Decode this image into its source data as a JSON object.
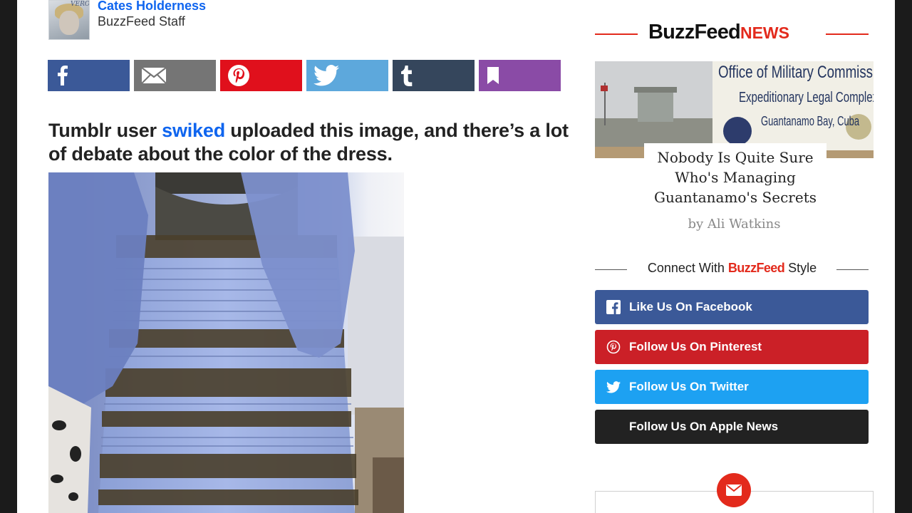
{
  "author": {
    "name": "Cates Holderness",
    "role": "BuzzFeed Staff",
    "avatar_text": "VERO"
  },
  "share_buttons": [
    {
      "name": "share-facebook-button",
      "icon": "facebook-icon",
      "color": "#3b5998"
    },
    {
      "name": "share-email-button",
      "icon": "email-icon",
      "color": "#757575"
    },
    {
      "name": "share-pinterest-button",
      "icon": "pinterest-icon",
      "color": "#e0101c"
    },
    {
      "name": "share-twitter-button",
      "icon": "twitter-icon",
      "color": "#5da8dc"
    },
    {
      "name": "share-tumblr-button",
      "icon": "tumblr-icon",
      "color": "#35465c"
    },
    {
      "name": "share-bookmark-button",
      "icon": "bookmark-icon",
      "color": "#8a4ba6"
    }
  ],
  "article": {
    "lead_before": "Tumblr user ",
    "lead_link": "swiked",
    "lead_after": " uploaded this image, and there’s a lot of debate about the color of the dress."
  },
  "sidebar": {
    "brand_primary": "BuzzFeed",
    "brand_secondary": "NEWS",
    "promo": {
      "sign_line1": "Office of Military Commissio",
      "sign_line2": "Expeditionary Legal Complex",
      "sign_line3": "Guantanamo Bay, Cuba",
      "title": "Nobody Is Quite Sure Who's Managing Guantanamo's Secrets",
      "byline": "by Ali Watkins"
    },
    "connect": {
      "prefix": "Connect With ",
      "brand": "BuzzFeed",
      "suffix": " Style"
    },
    "follow_buttons": [
      {
        "label": "Like Us On Facebook",
        "icon": "facebook-icon",
        "color": "#3b5998"
      },
      {
        "label": "Follow Us On Pinterest",
        "icon": "pinterest-icon",
        "color": "#cb2027"
      },
      {
        "label": "Follow Us On Twitter",
        "icon": "twitter-icon",
        "color": "#1da1f2"
      },
      {
        "label": "Follow Us On Apple News",
        "icon": "apple-icon",
        "color": "#222222"
      }
    ],
    "newsletter_icon": "email-icon"
  },
  "colors": {
    "accent_red": "#e32a1c",
    "link_blue": "#0f65ef"
  }
}
